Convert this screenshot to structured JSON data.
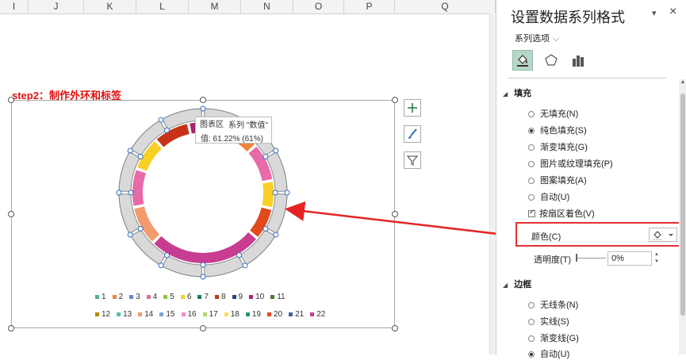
{
  "sheet": {
    "columns": [
      "I",
      "J",
      "K",
      "L",
      "M",
      "N",
      "O",
      "P",
      "Q"
    ],
    "step_title": "step2：制作外环和标签"
  },
  "chart": {
    "tooltip": {
      "area_label": "图表区",
      "series_line": "系列 \"数值\"",
      "value_line": "值: 61.22% (61%)"
    },
    "ring_colors": [
      "#c8287a",
      "#e33b1e",
      "#fad027",
      "#f4d83a",
      "#e04a1c",
      "#dd3ea0",
      "#d6389a",
      "#cc3495",
      "#f0843d",
      "#e38dcd",
      "#fbd42c",
      "#c83217",
      "#a6246f",
      "#f2c0d8"
    ],
    "legend": [
      {
        "label": "1",
        "color": "#4daf9d"
      },
      {
        "label": "2",
        "color": "#f0843d"
      },
      {
        "label": "3",
        "color": "#5b8bc9"
      },
      {
        "label": "4",
        "color": "#e86aa8"
      },
      {
        "label": "5",
        "color": "#8cc63f"
      },
      {
        "label": "6",
        "color": "#fad027"
      },
      {
        "label": "7",
        "color": "#1e7b5e"
      },
      {
        "label": "8",
        "color": "#c83217"
      },
      {
        "label": "9",
        "color": "#20497f"
      },
      {
        "label": "10",
        "color": "#a6246f"
      },
      {
        "label": "11",
        "color": "#4a7a2a"
      },
      {
        "label": "12",
        "color": "#b8860b"
      },
      {
        "label": "13",
        "color": "#5bc0b0"
      },
      {
        "label": "14",
        "color": "#f39b6d"
      },
      {
        "label": "15",
        "color": "#7fa1d6"
      },
      {
        "label": "16",
        "color": "#ee8cc0"
      },
      {
        "label": "17",
        "color": "#b4d96b"
      },
      {
        "label": "18",
        "color": "#fbdb63"
      },
      {
        "label": "19",
        "color": "#2a9676"
      },
      {
        "label": "20",
        "color": "#e04a1c"
      },
      {
        "label": "21",
        "color": "#3c64a6"
      },
      {
        "label": "22",
        "color": "#c83c92"
      }
    ]
  },
  "pane": {
    "title": "设置数据系列格式",
    "series_options": "系列选项",
    "fill_section": "填充",
    "fill_options": [
      {
        "label": "无填充(N)",
        "selected": false
      },
      {
        "label": "纯色填充(S)",
        "selected": true
      },
      {
        "label": "渐变填充(G)",
        "selected": false
      },
      {
        "label": "图片或纹理填充(P)",
        "selected": false
      },
      {
        "label": "图案填充(A)",
        "selected": false
      },
      {
        "label": "自动(U)",
        "selected": false
      }
    ],
    "vary_colors": "按扇区着色(V)",
    "color_label": "颜色(C)",
    "transparency_label": "透明度(T)",
    "transparency_value": "0%",
    "border_section": "边框",
    "border_options": [
      {
        "label": "无线条(N)",
        "selected": false
      },
      {
        "label": "实线(S)",
        "selected": false
      },
      {
        "label": "渐变线(G)",
        "selected": false
      },
      {
        "label": "自动(U)",
        "selected": true
      }
    ],
    "accent_color": "#217346",
    "highlight_color": "#e53030"
  }
}
